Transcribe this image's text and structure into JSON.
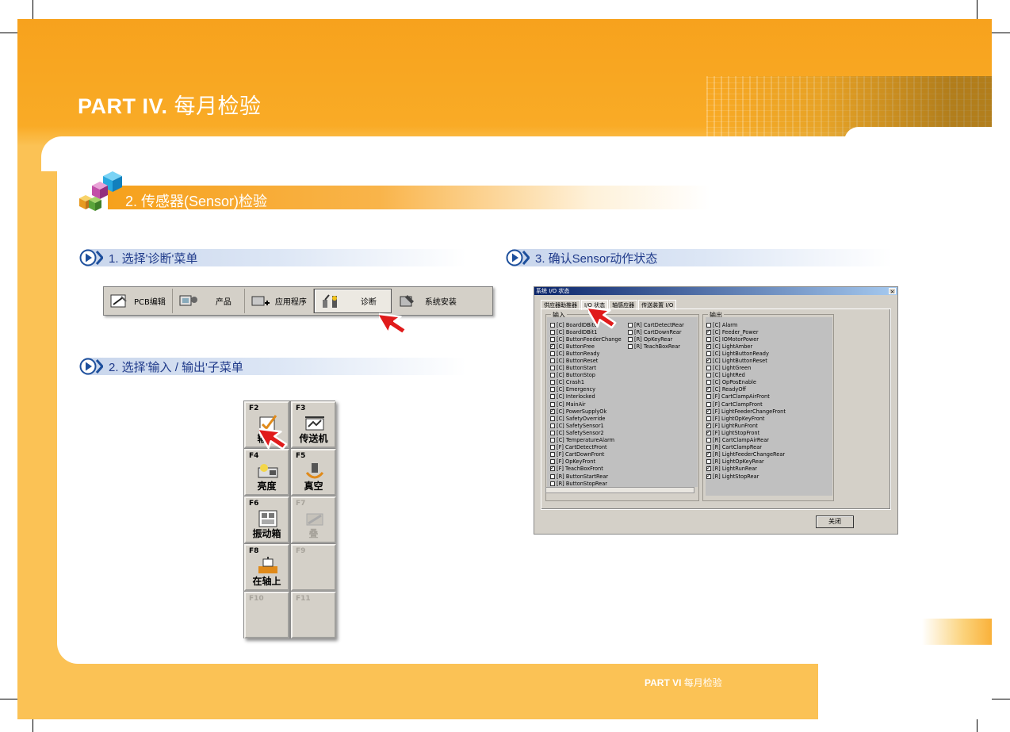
{
  "header": {
    "part": "PART IV.",
    "title": "每月检验"
  },
  "section": {
    "title": "2. 传感器(Sensor)检验"
  },
  "steps": {
    "s1": "1. 选择'诊断'菜单",
    "s2": "2. 选择'输入 / 输出'子菜单",
    "s3": "3. 确认Sensor动作状态"
  },
  "toolbar": {
    "items": [
      {
        "label": "PCB编辑",
        "icon": "pcb-edit-icon"
      },
      {
        "label": "产品",
        "icon": "product-icon"
      },
      {
        "label": "应用程序",
        "icon": "application-icon"
      },
      {
        "label": "诊断",
        "icon": "diagnosis-icon"
      },
      {
        "label": "系统安装",
        "icon": "system-setup-icon"
      }
    ],
    "active": "诊断"
  },
  "fkeys": [
    {
      "code": "F2",
      "label": "输入",
      "enabled": true
    },
    {
      "code": "F3",
      "label": "传送机",
      "enabled": true
    },
    {
      "code": "F4",
      "label": "亮度",
      "enabled": true
    },
    {
      "code": "F5",
      "label": "真空",
      "enabled": true
    },
    {
      "code": "F6",
      "label": "振动箱",
      "enabled": true
    },
    {
      "code": "F7",
      "label": "叠",
      "enabled": false
    },
    {
      "code": "F8",
      "label": "在轴上",
      "enabled": true
    },
    {
      "code": "F9",
      "label": "",
      "enabled": false
    },
    {
      "code": "F10",
      "label": "",
      "enabled": false
    },
    {
      "code": "F11",
      "label": "",
      "enabled": false
    }
  ],
  "dialog": {
    "title": "系统 I/O 状态",
    "tabs": [
      "供应器助推器",
      "I/O 状态",
      "轴感应器",
      "传送装置 I/O"
    ],
    "active_tab": "I/O 状态",
    "input_group": "输入",
    "output_group": "输出",
    "close_button": "关闭",
    "inputs_left": [
      {
        "name": "[C] BoardIDBit0",
        "on": false
      },
      {
        "name": "[C] BoardIDBit1",
        "on": false
      },
      {
        "name": "[C] ButtonFeederChange",
        "on": false
      },
      {
        "name": "[C] ButtonFree",
        "on": true
      },
      {
        "name": "[C] ButtonReady",
        "on": false
      },
      {
        "name": "[C] ButtonReset",
        "on": false
      },
      {
        "name": "[C] ButtonStart",
        "on": false
      },
      {
        "name": "[C] ButtonStop",
        "on": false
      },
      {
        "name": "[C] Crash1",
        "on": false
      },
      {
        "name": "[C] Emergency",
        "on": false
      },
      {
        "name": "[C] Interlocked",
        "on": false
      },
      {
        "name": "[C] MainAir",
        "on": false
      },
      {
        "name": "[C] PowerSupplyOk",
        "on": true
      },
      {
        "name": "[C] SafetyOverride",
        "on": false
      },
      {
        "name": "[C] SafetySensor1",
        "on": false
      },
      {
        "name": "[C] SafetySensor2",
        "on": false
      },
      {
        "name": "[C] TemperatureAlarm",
        "on": false
      },
      {
        "name": "[F] CartDetectFront",
        "on": false
      },
      {
        "name": "[F] CartDownFront",
        "on": false
      },
      {
        "name": "[F] OpKeyFront",
        "on": false
      },
      {
        "name": "[F] TeachBoxFront",
        "on": true
      },
      {
        "name": "[R] ButtonStartRear",
        "on": false
      },
      {
        "name": "[R] ButtonStopRear",
        "on": false
      }
    ],
    "inputs_right": [
      {
        "name": "[R] CartDetectRear",
        "on": false
      },
      {
        "name": "[R] CartDownRear",
        "on": false
      },
      {
        "name": "[R] OpKeyRear",
        "on": false
      },
      {
        "name": "[R] TeachBoxRear",
        "on": false
      }
    ],
    "outputs": [
      {
        "name": "[C] Alarm",
        "on": false
      },
      {
        "name": "[C] Feeder_Power",
        "on": true
      },
      {
        "name": "[C] IOMotorPower",
        "on": false
      },
      {
        "name": "[C] LightAmber",
        "on": true
      },
      {
        "name": "[C] LightButtonReady",
        "on": false
      },
      {
        "name": "[C] LightButtonReset",
        "on": true
      },
      {
        "name": "[C] LightGreen",
        "on": false
      },
      {
        "name": "[C] LightRed",
        "on": false
      },
      {
        "name": "[C] OpPosEnable",
        "on": false
      },
      {
        "name": "[C] ReadyOff",
        "on": true
      },
      {
        "name": "[F] CartClampAirFront",
        "on": false
      },
      {
        "name": "[F] CartClampFront",
        "on": false
      },
      {
        "name": "[F] LightFeederChangeFront",
        "on": true
      },
      {
        "name": "[F] LightOpKeyFront",
        "on": false
      },
      {
        "name": "[F] LightRunFront",
        "on": true
      },
      {
        "name": "[F] LightStopFront",
        "on": true
      },
      {
        "name": "[R] CartClampAirRear",
        "on": false
      },
      {
        "name": "[R] CartClampRear",
        "on": false
      },
      {
        "name": "[R] LightFeederChangeRear",
        "on": true
      },
      {
        "name": "[R] LightOpKeyRear",
        "on": false
      },
      {
        "name": "[R] LightRunRear",
        "on": true
      },
      {
        "name": "[R] LightStopRear",
        "on": true
      }
    ]
  },
  "footer": {
    "part": "PART VI",
    "title": "每月检验"
  },
  "colors": {
    "orange": "#f7a21d",
    "light_orange": "#fbc255",
    "step_text": "#1f3a8a",
    "arrow_red": "#e01b1b"
  }
}
